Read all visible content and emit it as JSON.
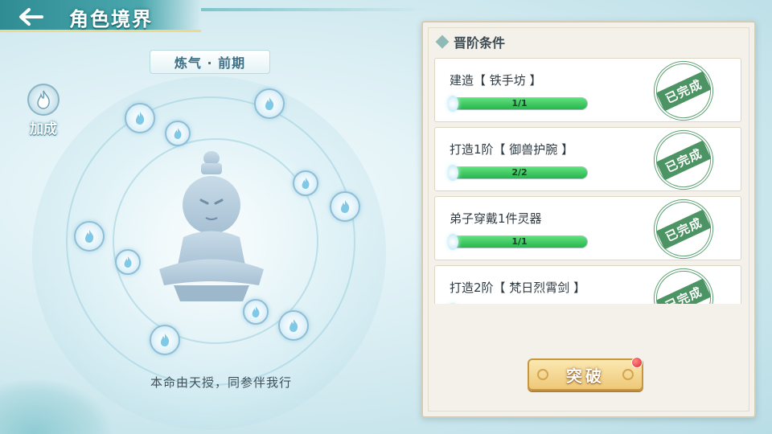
{
  "header": {
    "title": "角色境界",
    "back_icon": "back-arrow-icon"
  },
  "realm": {
    "name": "炼气 · 前期"
  },
  "bonus": {
    "label": "加成",
    "icon": "flame-icon"
  },
  "motto": "本命由天授，同参伴我行",
  "panel": {
    "title": "晋阶条件",
    "conditions": [
      {
        "title": "建造【 铁手坊 】",
        "progress": "1/1",
        "fraction": 1.0,
        "status": "已完成"
      },
      {
        "title": "打造1阶【 御兽护腕 】",
        "progress": "2/2",
        "fraction": 1.0,
        "status": "已完成"
      },
      {
        "title": "弟子穿戴1件灵器",
        "progress": "1/1",
        "fraction": 1.0,
        "status": "已完成"
      },
      {
        "title": "打造2阶【 梵日烈霄剑 】",
        "progress": "",
        "fraction": 1.0,
        "status": "已完成"
      }
    ]
  },
  "actions": {
    "break_label": "突破",
    "has_notification": true
  },
  "colors": {
    "accent": "#2f8c93",
    "complete_green": "#3e8b57",
    "button_gold": "#eec878"
  }
}
